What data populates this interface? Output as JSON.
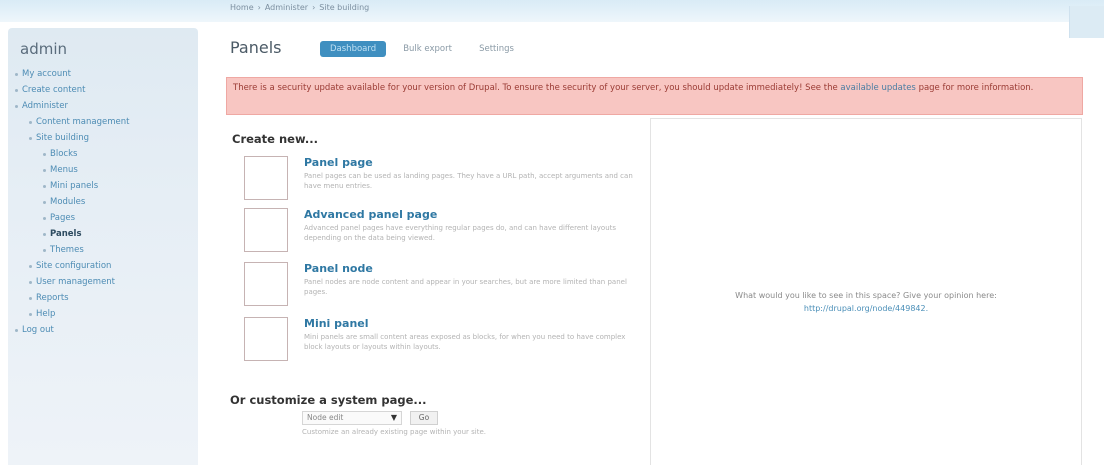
{
  "breadcrumb": [
    "Home",
    "›",
    "Administer",
    "›",
    "Site building"
  ],
  "sidebar": {
    "username": "admin",
    "items": [
      {
        "label": "My account",
        "level": 0
      },
      {
        "label": "Create content",
        "level": 0
      },
      {
        "label": "Administer",
        "level": 0
      },
      {
        "label": "Content management",
        "level": 1
      },
      {
        "label": "Site building",
        "level": 1
      },
      {
        "label": "Blocks",
        "level": 2
      },
      {
        "label": "Menus",
        "level": 2
      },
      {
        "label": "Mini panels",
        "level": 2
      },
      {
        "label": "Modules",
        "level": 2
      },
      {
        "label": "Pages",
        "level": 2
      },
      {
        "label": "Panels",
        "level": 2,
        "active": true
      },
      {
        "label": "Themes",
        "level": 2
      },
      {
        "label": "Site configuration",
        "level": 1
      },
      {
        "label": "User management",
        "level": 1
      },
      {
        "label": "Reports",
        "level": 1
      },
      {
        "label": "Help",
        "level": 1
      },
      {
        "label": "Log out",
        "level": 0
      }
    ]
  },
  "main": {
    "title": "Panels",
    "tabs": [
      {
        "label": "Dashboard",
        "active": true
      },
      {
        "label": "Bulk export",
        "active": false
      },
      {
        "label": "Settings",
        "active": false
      }
    ],
    "alert": {
      "text": "There is a security update available for your version of Drupal. To ensure the security of your server, you should update immediately! See the",
      "link": "available updates",
      "tail": "page for more information."
    },
    "create_heading": "Create new...",
    "panel_types": [
      {
        "name": "Panel page",
        "desc": "Panel pages can be used as landing pages. They have a URL path, accept arguments and can have menu entries."
      },
      {
        "name": "Advanced panel page",
        "desc": "Advanced panel pages have everything regular pages do, and can have different layouts depending on the data being viewed."
      },
      {
        "name": "Panel node",
        "desc": "Panel nodes are node content and appear in your searches, but are more limited than panel pages."
      },
      {
        "name": "Mini panel",
        "desc": "Mini panels are small content areas exposed as blocks, for when you need to have complex block layouts or layouts within layouts."
      }
    ],
    "system_heading": "Or customize a system page...",
    "system_select_value": "Node edit",
    "go_label": "Go",
    "system_help": "Customize an already existing page within your site.",
    "info": {
      "text": "What would you like to see in this space? Give your opinion here:",
      "link": "http://drupal.org/node/449842."
    }
  }
}
